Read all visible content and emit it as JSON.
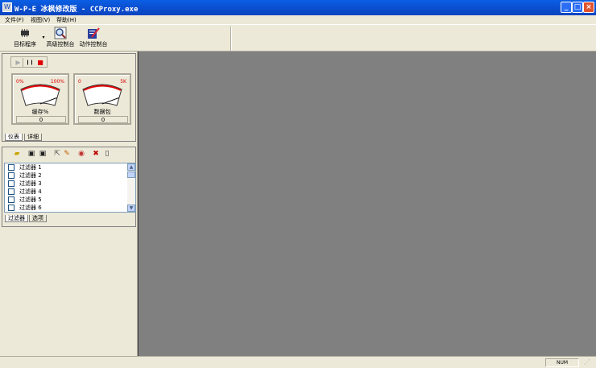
{
  "window": {
    "title": "W-P-E 冰枫修改版 - CCProxy.exe",
    "minimize_glyph": "_",
    "maximize_glyph": "□",
    "close_glyph": "×"
  },
  "menu": {
    "items": [
      {
        "label": "文件(F)"
      },
      {
        "label": "视图(V)"
      },
      {
        "label": "帮助(H)"
      }
    ]
  },
  "toolbar": {
    "buttons": [
      {
        "label": "目标程序",
        "icon": "chip-icon"
      },
      {
        "label": "高级控制台",
        "icon": "magnifier-icon"
      },
      {
        "label": "动作控制台",
        "icon": "pencil-icon"
      }
    ]
  },
  "capture": {
    "controls": [
      {
        "name": "play",
        "glyph": "▶"
      },
      {
        "name": "pause",
        "glyph": "❙❙"
      },
      {
        "name": "stop",
        "glyph": "■"
      }
    ]
  },
  "gauges": [
    {
      "min_label": "0%",
      "max_label": "100%",
      "caption": "缓存%",
      "value": "0",
      "fraction": 0
    },
    {
      "min_label": "0",
      "max_label": "5K",
      "caption": "数据包",
      "value": "0",
      "fraction": 0
    }
  ],
  "panel_tabs": [
    {
      "label": "仪表",
      "active": true
    },
    {
      "label": "详细",
      "active": false
    }
  ],
  "filters": {
    "items": [
      {
        "label": "过滤器 1",
        "checked": false
      },
      {
        "label": "过滤器 2",
        "checked": false
      },
      {
        "label": "过滤器 3",
        "checked": false
      },
      {
        "label": "过滤器 4",
        "checked": false
      },
      {
        "label": "过滤器 5",
        "checked": false
      },
      {
        "label": "过滤器 6",
        "checked": false
      }
    ],
    "tabs": [
      {
        "label": "过滤器",
        "active": true
      },
      {
        "label": "选项",
        "active": false
      }
    ]
  },
  "statusbar": {
    "indicator": "NUM"
  },
  "colors": {
    "titlebar": "#0b4fd1",
    "workspace": "#808080",
    "gauge_marks": "#e00000"
  }
}
